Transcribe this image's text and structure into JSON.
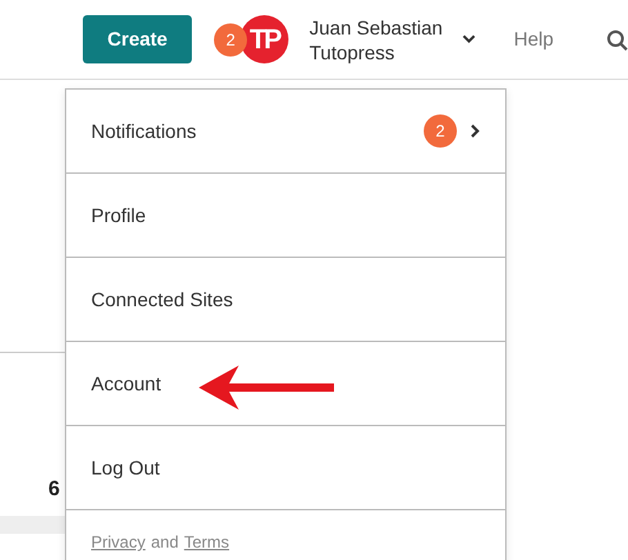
{
  "header": {
    "create_button": "Create",
    "notification_count": "2",
    "avatar": "TP",
    "user_name": [
      "Juan Sebastian",
      "Tutopress"
    ],
    "help": "Help"
  },
  "background": {
    "value_text": "6"
  },
  "menu": {
    "items": [
      {
        "label": "Notifications",
        "badge": "2",
        "kind": "submenu"
      },
      {
        "label": "Profile",
        "kind": "plain"
      },
      {
        "label": "Connected Sites",
        "kind": "plain"
      },
      {
        "label": "Account",
        "kind": "plain"
      },
      {
        "label": "Log Out",
        "kind": "plain"
      }
    ],
    "footer": {
      "privacy": "Privacy",
      "and": "and",
      "terms": "Terms"
    }
  },
  "annotation": {
    "kind": "arrow"
  }
}
